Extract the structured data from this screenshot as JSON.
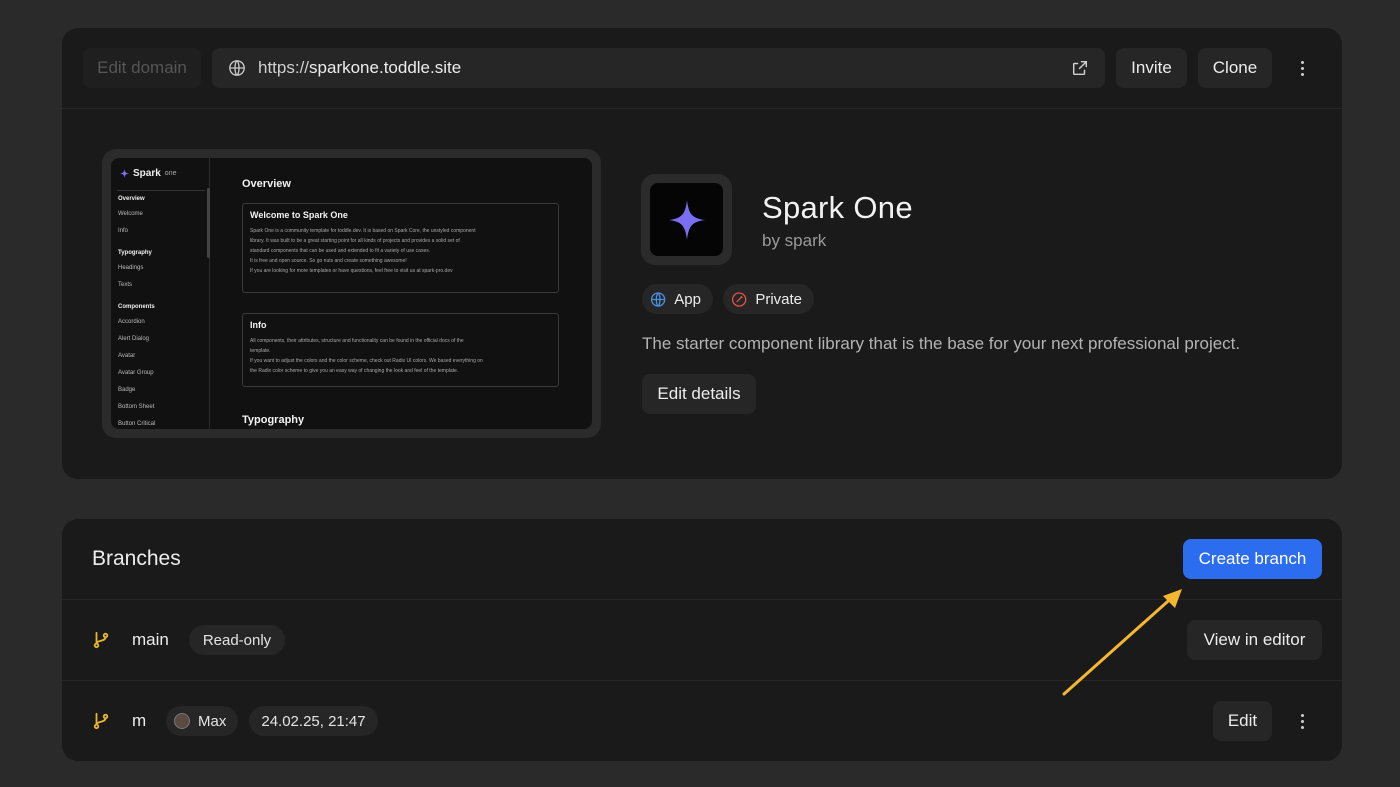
{
  "topbar": {
    "edit_domain_label": "Edit domain",
    "url_prefix": "https://",
    "url_host": "sparkone.toddle.site",
    "invite_label": "Invite",
    "clone_label": "Clone"
  },
  "preview": {
    "brand": "Spark",
    "brand_suffix": "one",
    "nav": [
      "Overview",
      "Welcome",
      "Info",
      "Typography",
      "Headings",
      "Texts",
      "Components",
      "Accordion",
      "Alert Dialog",
      "Avatar",
      "Avatar Group",
      "Badge",
      "Bottom Sheet",
      "Button Critical"
    ],
    "heading": "Overview",
    "box1_title": "Welcome to Spark One",
    "box1_lines": [
      "Spark One is a community template for toddle.dev. It is based on Spark Core, the unstyled component",
      "library. It was built to be a great starting point for all kinds of projects and provides a solid set of",
      "standard components that can be used and extended to fit a variety of use cases.",
      "It is free and open source. So go nuts and create something awesome!",
      "If you are looking for more templates or have questions, feel free to visit us at spark-pro.dev"
    ],
    "box2_title": "Info",
    "box2_lines": [
      "All components, their attributes, structure and functionality can be found in the official docs of the",
      "template.",
      "If you want to adjust the colors and the color scheme, check out Radix UI colors. We based everything on",
      "the Radix color scheme to give you an easy way of changing the look and feel of the template."
    ],
    "heading2": "Typography"
  },
  "project": {
    "title": "Spark One",
    "author": "by spark",
    "type_badge": "App",
    "visibility_badge": "Private",
    "description": "The starter component library that is the base for your next professional project.",
    "edit_details_label": "Edit details"
  },
  "branches": {
    "title": "Branches",
    "create_label": "Create branch",
    "rows": [
      {
        "name": "main",
        "tag": "Read-only",
        "action": "View in editor"
      },
      {
        "name": "m",
        "author": "Max",
        "date": "24.02.25, 21:47",
        "action": "Edit"
      }
    ]
  },
  "colors": {
    "accent": "#2c6df0",
    "branch_icon": "#e8b530",
    "annotation_arrow": "#f5b731",
    "private_icon": "#e0524b",
    "app_icon": "#4a8fe0",
    "star": "#7b6ef0"
  }
}
